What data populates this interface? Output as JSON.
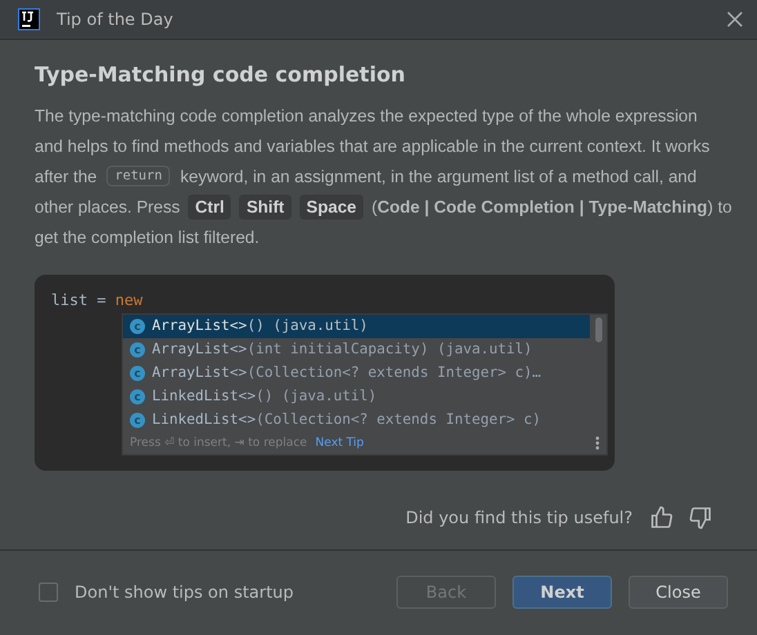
{
  "window": {
    "title": "Tip of the Day"
  },
  "tip": {
    "title": "Type-Matching code completion",
    "lines": [
      [
        {
          "kind": "text",
          "text": "The type-matching code completion analyzes the expected type of the whole expression"
        }
      ],
      [
        {
          "kind": "text",
          "text": "and helps to find methods and variables that are applicable in the current context. It works"
        }
      ],
      [
        {
          "kind": "text",
          "text": "after the"
        },
        {
          "kind": "code",
          "text": "return"
        },
        {
          "kind": "text",
          "text": "keyword, in an assignment, in the argument list of a method call, and"
        }
      ],
      [
        {
          "kind": "text",
          "text": "other places. Press"
        },
        {
          "kind": "key",
          "text": "Ctrl"
        },
        {
          "kind": "key",
          "text": "Shift"
        },
        {
          "kind": "key",
          "text": "Space"
        },
        {
          "kind": "text",
          "text": "(**Code | Code Completion | Type-Matching**) to"
        }
      ],
      [
        {
          "kind": "text",
          "text": "get the completion list filtered."
        }
      ]
    ]
  },
  "example": {
    "code": "list = ",
    "keyword": "new",
    "items": [
      {
        "icon": "c",
        "name": "ArrayList<>",
        "detail": "() (java.util)",
        "selected": true
      },
      {
        "icon": "c",
        "name": "ArrayList<>",
        "detail": "(int initialCapacity) (java.util)",
        "selected": false
      },
      {
        "icon": "c",
        "name": "ArrayList<>",
        "detail": "(Collection<? extends Integer> c)…",
        "selected": false
      },
      {
        "icon": "c",
        "name": "LinkedList<>",
        "detail": "() (java.util)",
        "selected": false
      },
      {
        "icon": "c",
        "name": "LinkedList<>",
        "detail": "(Collection<? extends Integer> c)",
        "selected": false
      }
    ],
    "hint": "Press ⏎ to insert, ⇥ to replace",
    "hint_link": "Next Tip"
  },
  "feedback": {
    "question": "Did you find this tip useful?"
  },
  "footer": {
    "checkbox": {
      "label": "Don't show tips on startup",
      "checked": false
    },
    "buttons": [
      {
        "label": "Back",
        "disabled": true,
        "primary": false
      },
      {
        "label": "Next",
        "disabled": false,
        "primary": true
      },
      {
        "label": "Close",
        "disabled": false,
        "primary": false
      }
    ]
  }
}
